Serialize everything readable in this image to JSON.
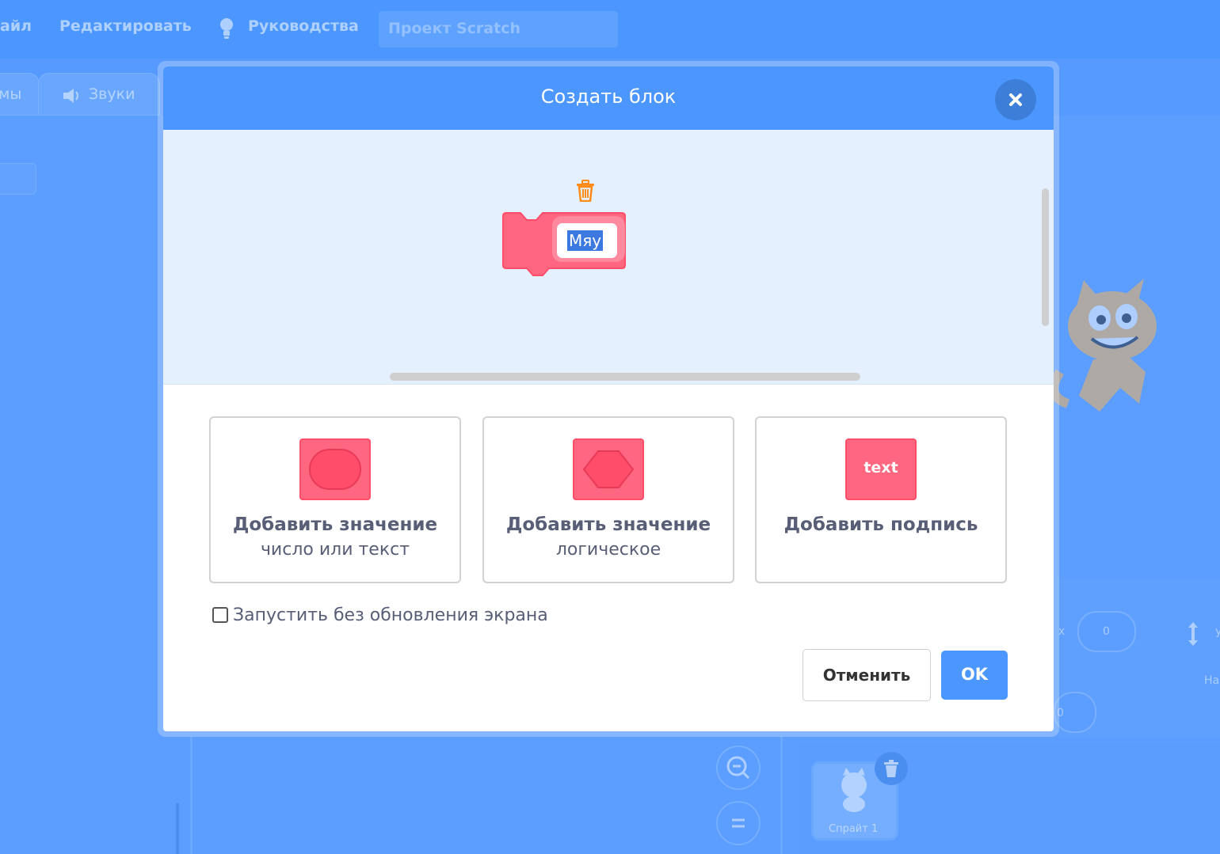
{
  "menubar": {
    "file_label": "айл",
    "edit_label": "Редактировать",
    "tutorials_label": "Руководства",
    "project_title": "Проект Scratch"
  },
  "tabs": {
    "costumes_label": "мы",
    "sounds_label": "Звуки"
  },
  "stage_info": {
    "x_label": "x",
    "x_value": "0",
    "y_label": "y",
    "y_value": "0",
    "size_label": "На"
  },
  "sprites": {
    "sprite1_name": "Спрайт 1"
  },
  "modal": {
    "title": "Создать блок",
    "block_name_value": "Мяу",
    "options": [
      {
        "title": "Добавить значение",
        "subtitle": "число или текст"
      },
      {
        "title": "Добавить значение",
        "subtitle": "логическое"
      },
      {
        "title": "Добавить подпись",
        "subtitle": "",
        "swatch_text": "text"
      }
    ],
    "run_without_refresh_label": "Запустить без обновления экрана",
    "cancel_label": "Отменить",
    "ok_label": "OK"
  },
  "colors": {
    "scratch_blue": "#4c97ff",
    "block_pink": "#ff6680",
    "block_pink_border": "#ff4d6a",
    "text_gray": "#575e75",
    "workspace_bg": "#e5f0ff",
    "trash_orange": "#ff8c1a"
  }
}
